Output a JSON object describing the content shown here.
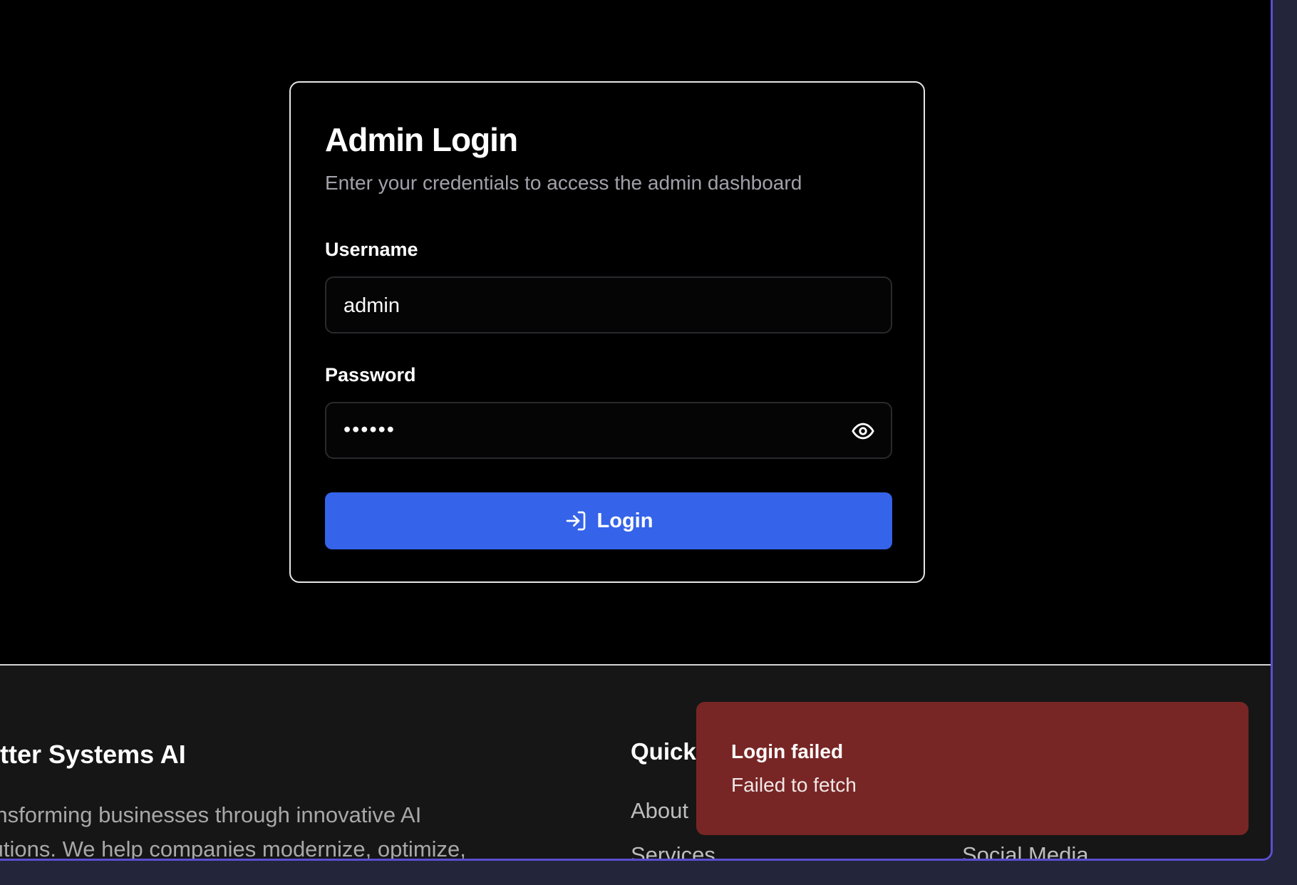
{
  "login": {
    "title": "Admin Login",
    "subtitle": "Enter your credentials to access the admin dashboard",
    "username_label": "Username",
    "username_value": "admin",
    "password_label": "Password",
    "password_masked": "••••••",
    "button_label": "Login",
    "button_color": "#3563e9"
  },
  "footer": {
    "brand": "Better Systems AI",
    "description": [
      "Transforming businesses through innovative AI",
      "solutions. We help companies modernize, optimize,"
    ],
    "quick_links_heading": "Quick Links",
    "links": [
      "About",
      "Services"
    ],
    "social_link": "Social Media"
  },
  "toast": {
    "title": "Login failed",
    "message": "Failed to fetch",
    "color": "#772625"
  },
  "icons": {
    "password_toggle": "eye-icon",
    "login": "log-in-icon"
  }
}
